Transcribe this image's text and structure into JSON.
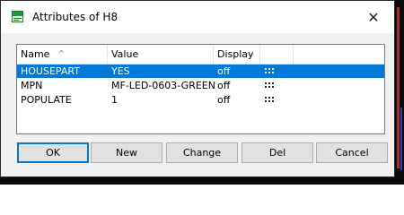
{
  "window": {
    "title": "Attributes of H8",
    "app_icon": "brd-icon",
    "close_icon": "close-icon"
  },
  "table": {
    "columns": [
      "Name",
      "Value",
      "Display"
    ],
    "sorted_column": "Name",
    "rows": [
      {
        "name": "HOUSEPART",
        "value": "YES",
        "display": "off",
        "selected": true
      },
      {
        "name": "MPN",
        "value": "MF-LED-0603-GREEN",
        "display": "off",
        "selected": false
      },
      {
        "name": "POPULATE",
        "value": "1",
        "display": "off",
        "selected": false
      }
    ]
  },
  "buttons": {
    "ok": "OK",
    "new": "New",
    "change": "Change",
    "del": "Del",
    "cancel": "Cancel"
  },
  "colors": {
    "selection": "#0078d7",
    "default_button_border": "#0078d7"
  }
}
